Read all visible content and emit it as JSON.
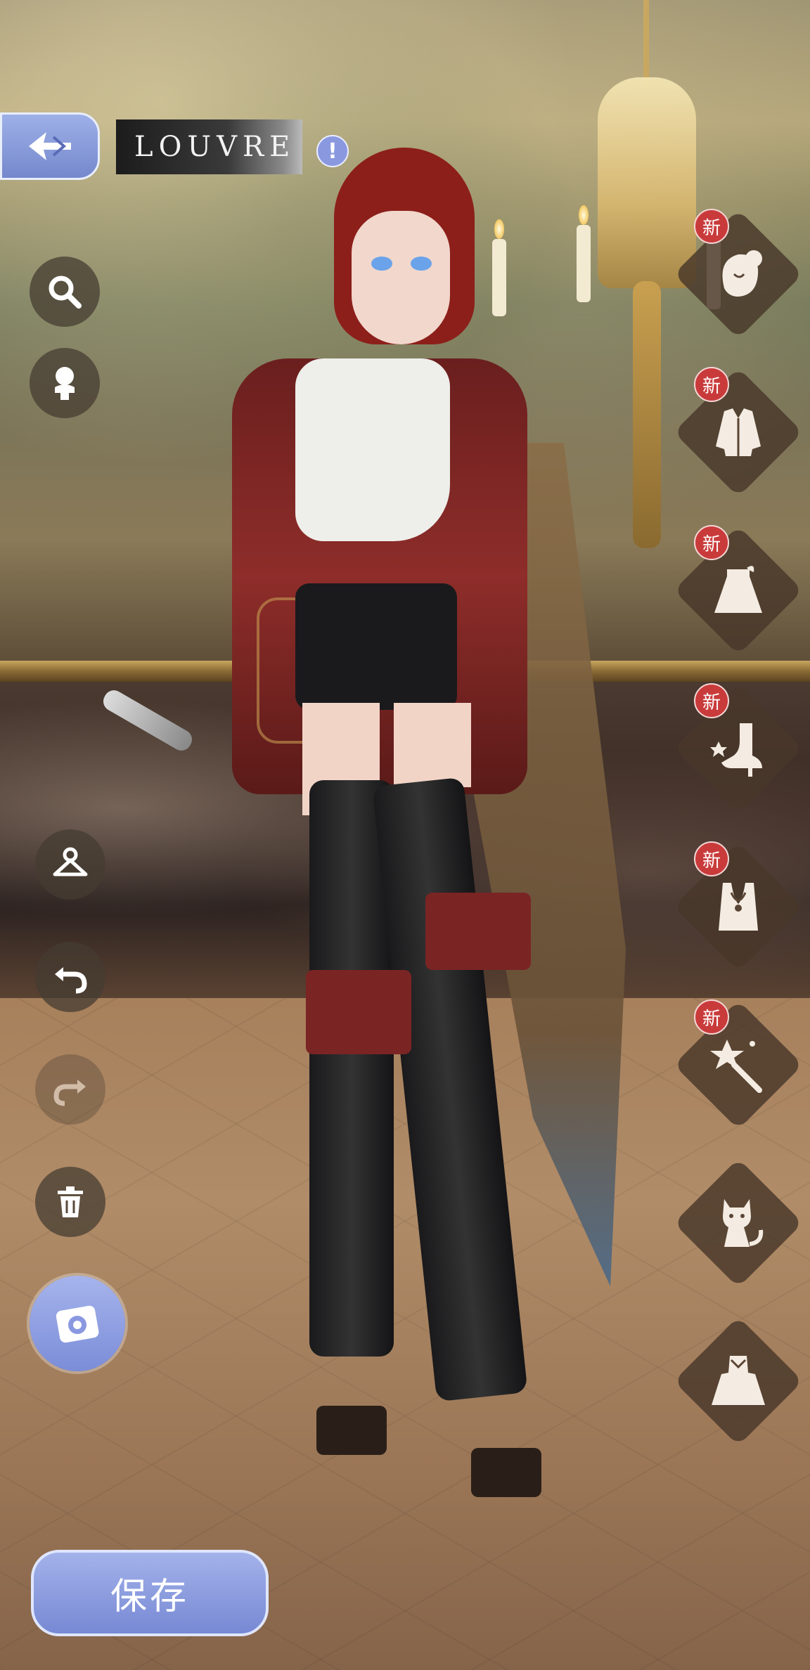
{
  "header": {
    "location_name": "LOUVRE",
    "info_icon": "!"
  },
  "side_tools": {
    "search": "search-icon",
    "makeup": "bust-icon",
    "wardrobe": "hanger-icon",
    "undo": "undo-icon",
    "redo": "redo-icon",
    "delete": "trash-icon",
    "camera": "camera-icon"
  },
  "categories": [
    {
      "name": "hair",
      "badge": "新"
    },
    {
      "name": "top",
      "badge": "新"
    },
    {
      "name": "skirt",
      "badge": "新"
    },
    {
      "name": "shoes",
      "badge": "新"
    },
    {
      "name": "necklace",
      "badge": "新"
    },
    {
      "name": "handheld",
      "badge": "新"
    },
    {
      "name": "pet",
      "badge": ""
    },
    {
      "name": "dress",
      "badge": ""
    }
  ],
  "footer": {
    "save_label": "保存"
  },
  "colors": {
    "accent": "#8a98e0",
    "badge": "#c93b3b"
  }
}
